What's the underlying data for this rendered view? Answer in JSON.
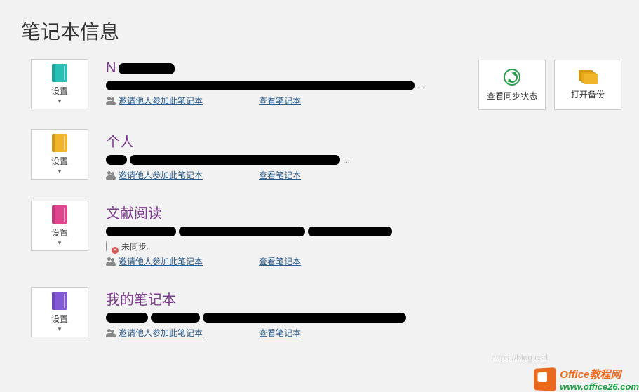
{
  "title": "笔记本信息",
  "actions": {
    "sync_label": "查看同步状态",
    "backup_label": "打开备份"
  },
  "settings_label": "设置",
  "links": {
    "invite": "邀请他人参加此笔记本",
    "view": "查看笔记本"
  },
  "notebooks": [
    {
      "name": "N",
      "color": "teal",
      "path_suffix": "...",
      "status": null
    },
    {
      "name": "个人",
      "color": "yellow",
      "path_suffix": "...",
      "status": null
    },
    {
      "name": "文献阅读",
      "color": "pink",
      "path_suffix": "",
      "status": "未同步。"
    },
    {
      "name": "我的笔记本",
      "color": "purple",
      "path_suffix": "",
      "status": null
    }
  ],
  "watermark": {
    "line1": "Office教程网",
    "line2": "www.office26.com"
  },
  "faint_url": "https://blog.csd"
}
